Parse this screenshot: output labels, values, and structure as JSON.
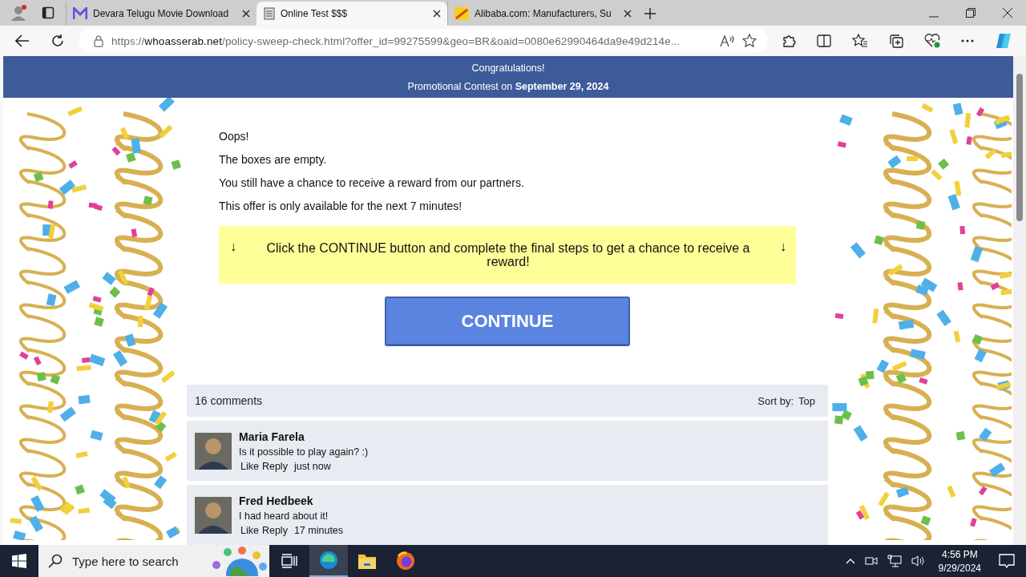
{
  "browser": {
    "tabs": [
      {
        "title": "Devara Telugu Movie Download",
        "kind": "mail",
        "selected": false
      },
      {
        "title": "Online Test $$$",
        "kind": "document",
        "selected": true
      },
      {
        "title": "Alibaba.com: Manufacturers, Su",
        "kind": "store",
        "selected": false
      }
    ],
    "url": {
      "scheme": "https://",
      "host": "whoasserab.net",
      "rest": "/policy-sweep-check.html?offer_id=99275599&geo=BR&oaid=0080e62990464da9e49d214e..."
    }
  },
  "header": {
    "title": "Congratulations!",
    "subtitle": "Promotional Contest on **September 29, 2024**"
  },
  "messages": [
    "Oops!",
    "The boxes are empty.",
    "You still have a chance to receive a reward from our partners.",
    "This offer is only available for the next 7 minutes!"
  ],
  "notice": {
    "arrow_left": "↓",
    "text": "Click the CONTINUE button and complete the final steps to get a chance to receive a reward!",
    "arrow_right": "↓"
  },
  "continue_button": "CONTINUE",
  "comments": {
    "count": "16 comments",
    "sort_label": "Sort by:",
    "sort_value": "Top",
    "items": [
      {
        "name": "Maria Farela",
        "text": "Is it possible to play again? :)",
        "like": "Like",
        "reply": "Reply",
        "time": "just now"
      },
      {
        "name": "Fred Hedbeek",
        "text": "I had heard about it!",
        "like": "Like",
        "reply": "Reply",
        "time": "17 minutes"
      }
    ]
  },
  "taskbar": {
    "search_placeholder": "Type here to search",
    "time": "4:56 PM",
    "date": "9/29/2024"
  }
}
